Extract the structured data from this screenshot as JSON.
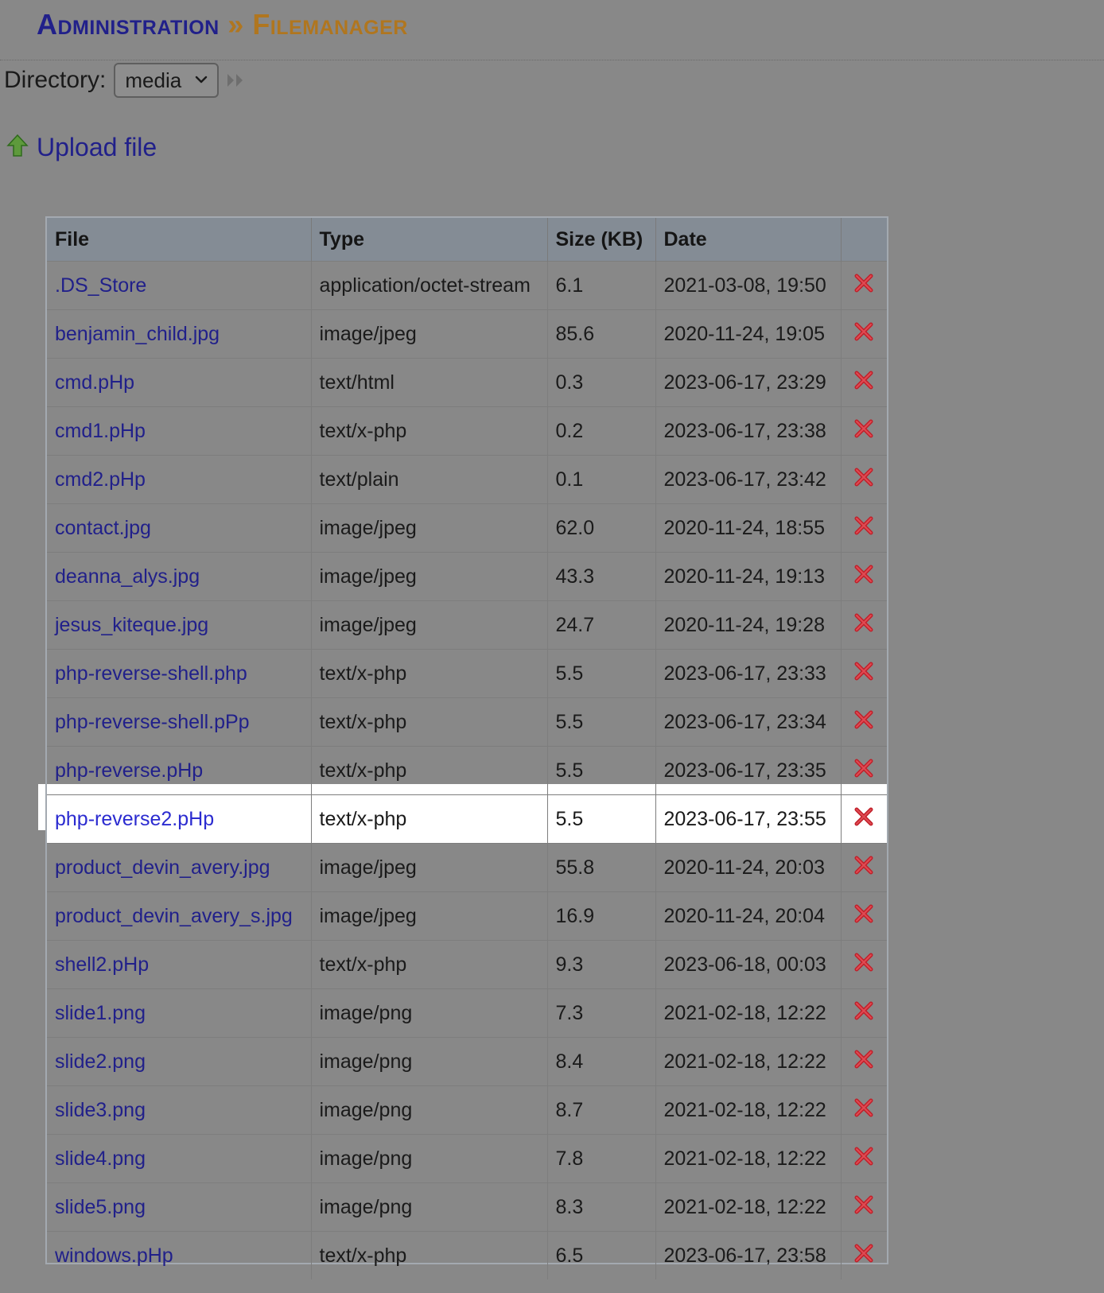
{
  "header": {
    "admin": "Administration",
    "separator": "»",
    "section": "Filemanager"
  },
  "directory": {
    "label": "Directory:",
    "selected": "media"
  },
  "upload": {
    "label": "Upload file"
  },
  "table": {
    "columns": [
      "File",
      "Type",
      "Size (KB)",
      "Date",
      ""
    ],
    "rows": [
      {
        "name": ".DS_Store",
        "type": "application/octet-stream",
        "size": "6.1",
        "date": "2021-03-08, 19:50"
      },
      {
        "name": "benjamin_child.jpg",
        "type": "image/jpeg",
        "size": "85.6",
        "date": "2020-11-24, 19:05"
      },
      {
        "name": "cmd.pHp",
        "type": "text/html",
        "size": "0.3",
        "date": "2023-06-17, 23:29"
      },
      {
        "name": "cmd1.pHp",
        "type": "text/x-php",
        "size": "0.2",
        "date": "2023-06-17, 23:38"
      },
      {
        "name": "cmd2.pHp",
        "type": "text/plain",
        "size": "0.1",
        "date": "2023-06-17, 23:42"
      },
      {
        "name": "contact.jpg",
        "type": "image/jpeg",
        "size": "62.0",
        "date": "2020-11-24, 18:55"
      },
      {
        "name": "deanna_alys.jpg",
        "type": "image/jpeg",
        "size": "43.3",
        "date": "2020-11-24, 19:13"
      },
      {
        "name": "jesus_kiteque.jpg",
        "type": "image/jpeg",
        "size": "24.7",
        "date": "2020-11-24, 19:28"
      },
      {
        "name": "php-reverse-shell.php",
        "type": "text/x-php",
        "size": "5.5",
        "date": "2023-06-17, 23:33"
      },
      {
        "name": "php-reverse-shell.pPp",
        "type": "text/x-php",
        "size": "5.5",
        "date": "2023-06-17, 23:34"
      },
      {
        "name": "php-reverse.pHp",
        "type": "text/x-php",
        "size": "5.5",
        "date": "2023-06-17, 23:35"
      },
      {
        "name": "php-reverse2.pHp",
        "type": "text/x-php",
        "size": "5.5",
        "date": "2023-06-17, 23:55",
        "highlighted": true
      },
      {
        "name": "product_devin_avery.jpg",
        "type": "image/jpeg",
        "size": "55.8",
        "date": "2020-11-24, 20:03"
      },
      {
        "name": "product_devin_avery_s.jpg",
        "type": "image/jpeg",
        "size": "16.9",
        "date": "2020-11-24, 20:04"
      },
      {
        "name": "shell2.pHp",
        "type": "text/x-php",
        "size": "9.3",
        "date": "2023-06-18, 00:03"
      },
      {
        "name": "slide1.png",
        "type": "image/png",
        "size": "7.3",
        "date": "2021-02-18, 12:22"
      },
      {
        "name": "slide2.png",
        "type": "image/png",
        "size": "8.4",
        "date": "2021-02-18, 12:22"
      },
      {
        "name": "slide3.png",
        "type": "image/png",
        "size": "8.7",
        "date": "2021-02-18, 12:22"
      },
      {
        "name": "slide4.png",
        "type": "image/png",
        "size": "7.8",
        "date": "2021-02-18, 12:22"
      },
      {
        "name": "slide5.png",
        "type": "image/png",
        "size": "8.3",
        "date": "2021-02-18, 12:22"
      },
      {
        "name": "windows.pHp",
        "type": "text/x-php",
        "size": "6.5",
        "date": "2023-06-17, 23:58"
      }
    ]
  },
  "colors": {
    "background": "#888888",
    "link": "#21208a",
    "accent": "#b0761f",
    "delete": "#c0202a"
  },
  "icons": {
    "upload": "up-arrow-icon",
    "go": "double-chevron-right-icon",
    "delete": "red-x-icon"
  }
}
